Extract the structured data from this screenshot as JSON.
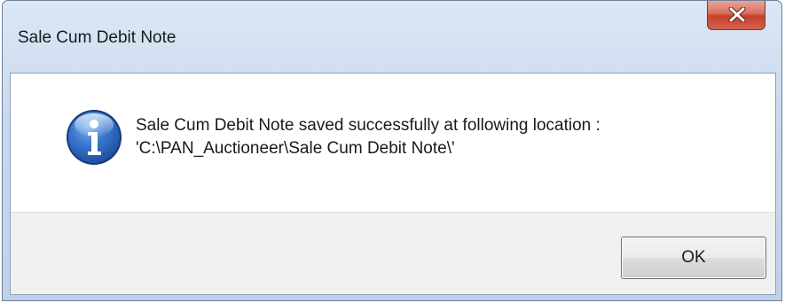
{
  "window": {
    "title": "Sale Cum Debit Note"
  },
  "dialog": {
    "icon": "info-icon",
    "message_line1": "Sale Cum Debit Note saved successfully at following location :",
    "message_line2": "'C:\\PAN_Auctioneer\\Sale Cum Debit Note\\'"
  },
  "buttons": {
    "ok_label": "OK",
    "close_icon": "close-icon"
  },
  "colors": {
    "title_bar": "#c9d9ee",
    "close_button": "#c5412c",
    "info_icon": "#2a63b8",
    "button_area": "#f0f0f0"
  }
}
